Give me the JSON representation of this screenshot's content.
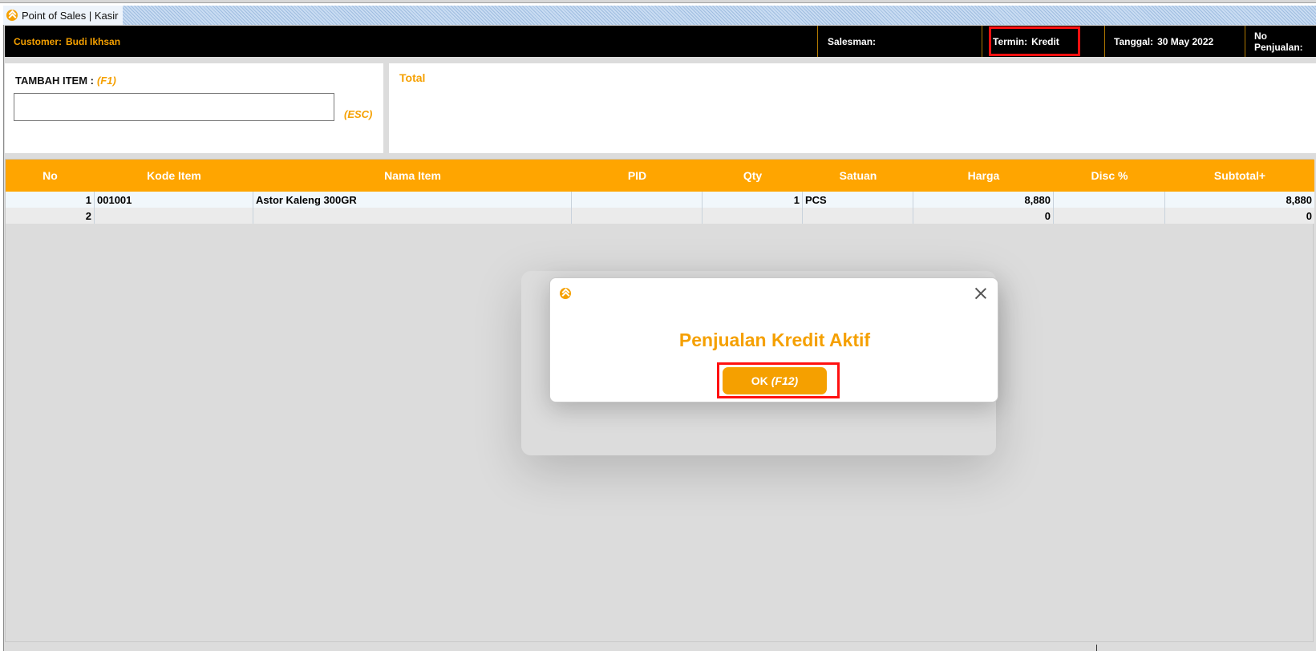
{
  "window": {
    "title": "Point of Sales | Kasir"
  },
  "infobar": {
    "customer_label": "Customer:",
    "customer_value": "Budi Ikhsan",
    "salesman_label": "Salesman:",
    "salesman_value": "",
    "termin_label": "Termin:",
    "termin_value": "Kredit",
    "tanggal_label": "Tanggal:",
    "tanggal_value": "30 May 2022",
    "no_penjualan_label": "No Penjualan:"
  },
  "add_item": {
    "label": "TAMBAH ITEM :",
    "shortcut": "(F1)",
    "input_value": "",
    "esc_label": "(ESC)"
  },
  "total": {
    "label": "Total"
  },
  "table": {
    "columns": [
      "No",
      "Kode Item",
      "Nama Item",
      "PID",
      "Qty",
      "Satuan",
      "Harga",
      "Disc %",
      "Subtotal+"
    ],
    "rows": [
      {
        "no": "1",
        "kode": "001001",
        "nama": "Astor Kaleng 300GR",
        "pid": "",
        "qty": "1",
        "satuan": "PCS",
        "harga": "8,880",
        "disc": "",
        "subtotal": "8,880"
      },
      {
        "no": "2",
        "kode": "",
        "nama": "",
        "pid": "",
        "qty": "",
        "satuan": "",
        "harga": "0",
        "disc": "",
        "subtotal": "0"
      }
    ]
  },
  "dialog": {
    "message": "Penjualan Kredit Aktif",
    "ok_label": "OK",
    "ok_shortcut": "(F12)"
  },
  "colors": {
    "accent": "#f5a000",
    "header_bg": "#000000",
    "highlight": "#ff1010"
  },
  "icons": {
    "app": "app-logo-icon",
    "close": "close-icon"
  }
}
